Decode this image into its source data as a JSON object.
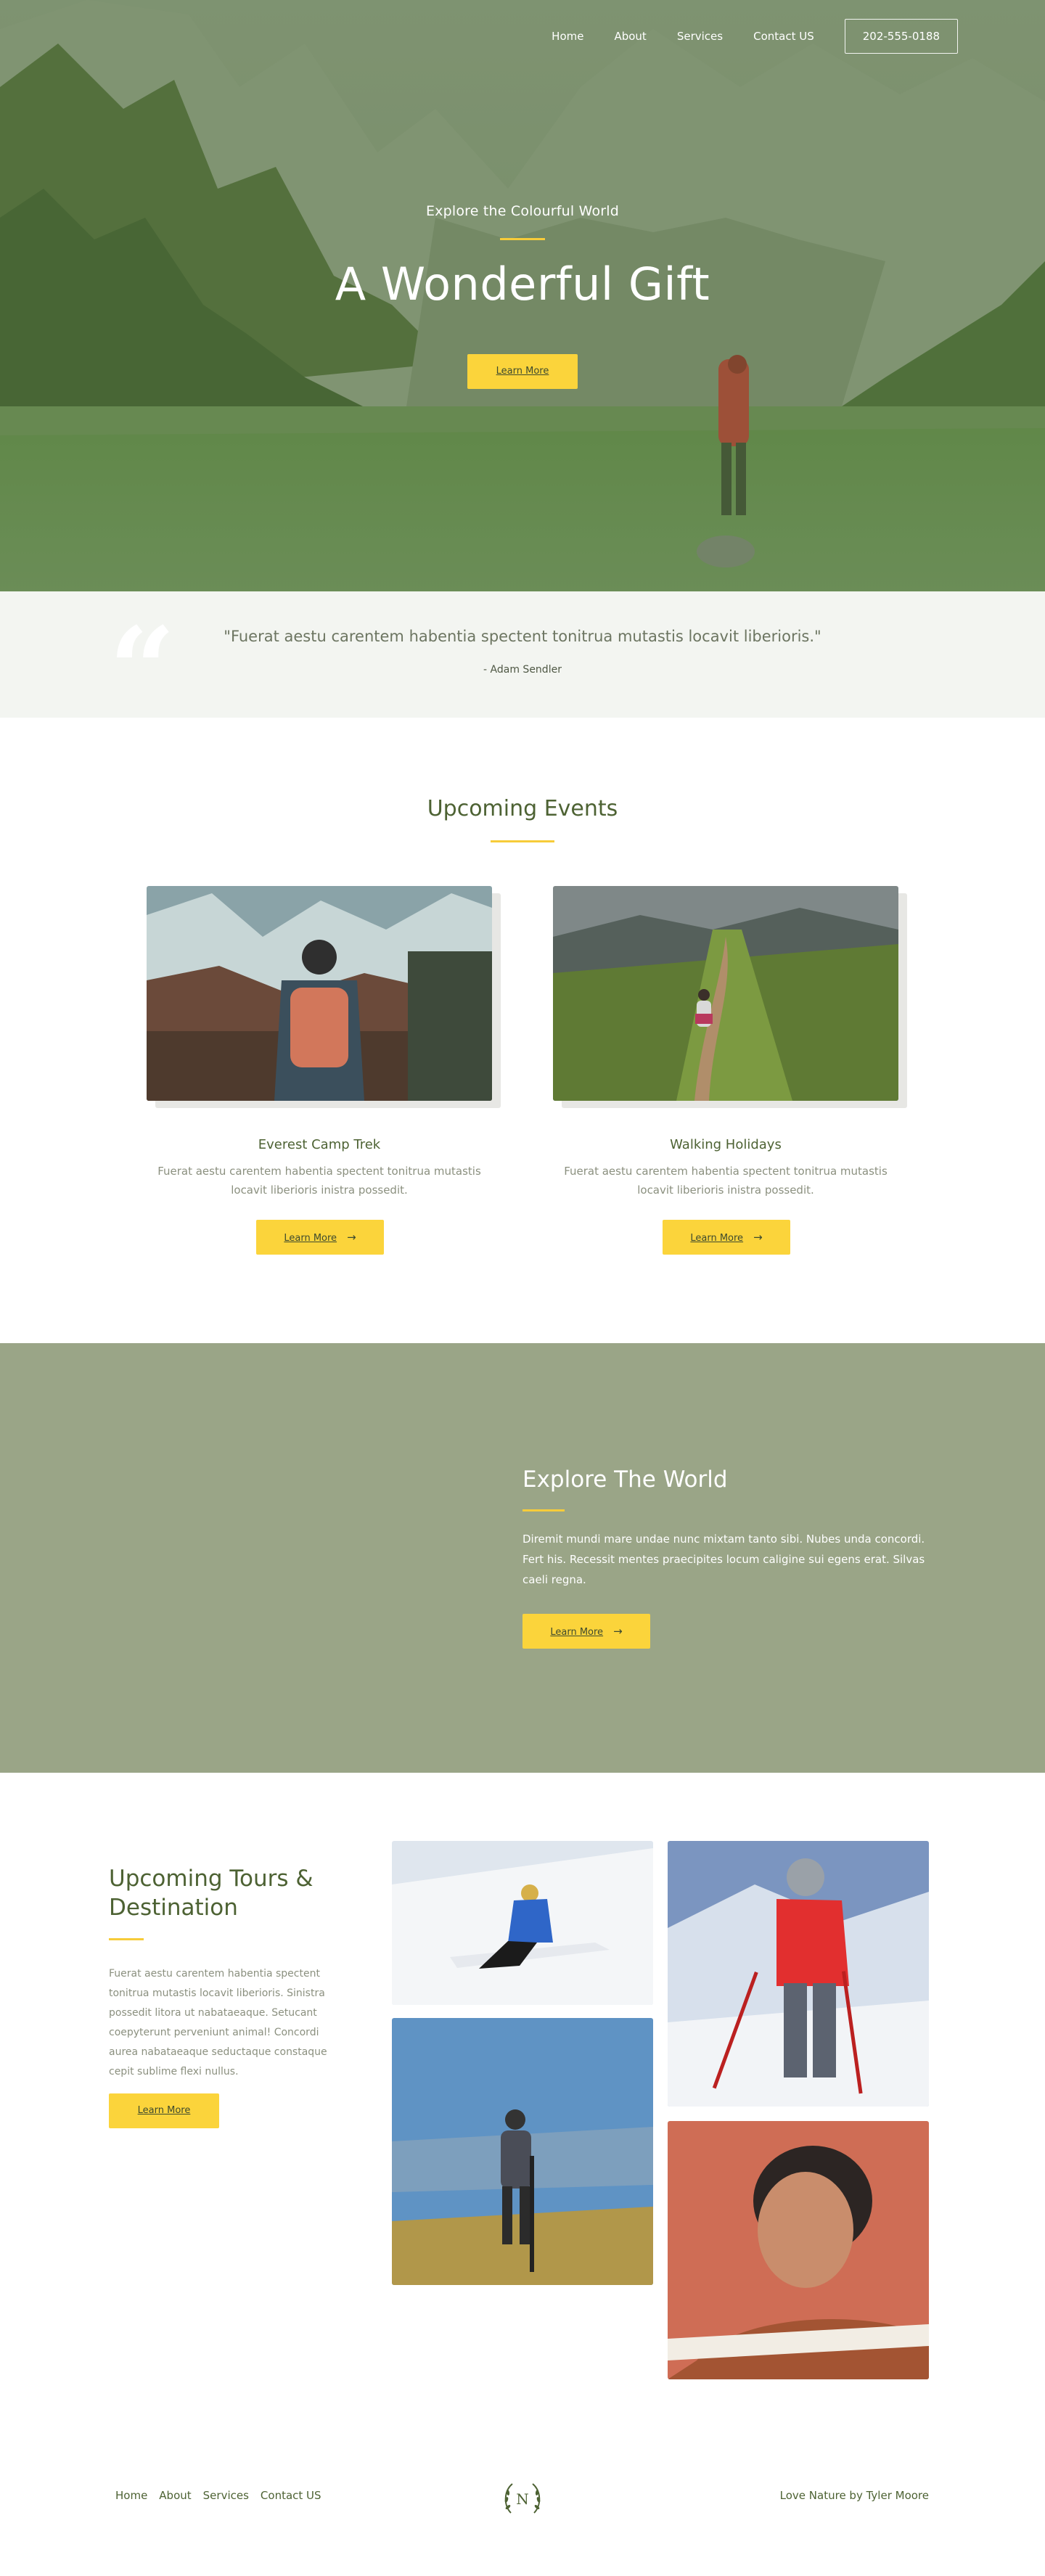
{
  "nav": {
    "items": [
      "Home",
      "About",
      "Services",
      "Contact US"
    ],
    "phone": "202-555-0188"
  },
  "hero": {
    "eyebrow": "Explore the Colourful World",
    "title": "A Wonderful Gift",
    "button": "Learn More"
  },
  "quote": {
    "text": "\"Fuerat aestu carentem habentia spectent tonitrua mutastis locavit liberioris.\"",
    "author": "- Adam Sendler",
    "mark": "“"
  },
  "events": {
    "title": "Upcoming Events",
    "cards": [
      {
        "title": "Everest Camp Trek",
        "desc_1": "Fuerat aestu carentem habentia spectent tonitrua mutastis",
        "desc_2": "locavit liberioris inistra possedit.",
        "button": "Learn More"
      },
      {
        "title": "Walking Holidays",
        "desc_1": "Fuerat aestu carentem habentia spectent tonitrua mutastis",
        "desc_2": "locavit liberioris inistra possedit.",
        "button": "Learn More"
      }
    ]
  },
  "explore": {
    "title": "Explore The World",
    "text": "Diremit mundi mare undae nunc mixtam tanto sibi. Nubes unda concordi. Fert his. Recessit mentes praecipites locum caligine sui egens erat. Silvas caeli regna.",
    "button": "Learn More"
  },
  "tours": {
    "title": "Upcoming Tours & Destination",
    "text": "Fuerat aestu carentem habentia spectent tonitrua mutastis locavit liberioris. Sinistra possedit litora ut nabataeaque. Setucant coepyterunt perveniunt animal! Concordi aurea nabataeaque seductaque constaque cepit sublime flexi nullus.",
    "button": "Learn More"
  },
  "footer": {
    "links": [
      "Home",
      "About",
      "Services",
      "Contact US"
    ],
    "logo_letter": "N",
    "credit": "Love Nature by Tyler Moore"
  },
  "colors": {
    "accent": "#fbd43b",
    "green_text": "#4d6233",
    "explore_bg": "#9aa587",
    "quote_bg": "#f3f5f1"
  }
}
